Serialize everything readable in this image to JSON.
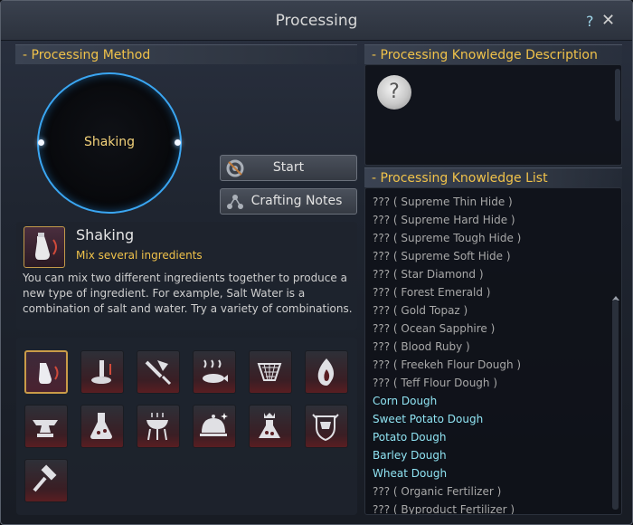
{
  "window": {
    "title": "Processing",
    "help_label": "?",
    "close_label": "✕"
  },
  "method_section": {
    "header": "- Processing Method"
  },
  "circle": {
    "label": "Shaking",
    "ring_color": "#3aa6f2"
  },
  "buttons": {
    "start": "Start",
    "crafting_notes": "Crafting Notes"
  },
  "selected_method": {
    "name": "Shaking",
    "subtitle": "Mix several ingredients",
    "description": "You can mix two different ingredients together to produce a new type of ingredient. For example, Salt Water is a combination of salt and water. Try a variety of combinations."
  },
  "method_icons": [
    {
      "name": "shaking-icon",
      "selected": true
    },
    {
      "name": "grinding-icon",
      "selected": false
    },
    {
      "name": "chopping-icon",
      "selected": false
    },
    {
      "name": "drying-icon",
      "selected": false
    },
    {
      "name": "filtering-icon",
      "selected": false
    },
    {
      "name": "heating-icon",
      "selected": false
    },
    {
      "name": "anvil-icon",
      "selected": false
    },
    {
      "name": "alchemy-flask-icon",
      "selected": false
    },
    {
      "name": "grill-icon",
      "selected": false
    },
    {
      "name": "cooking-cloche-icon",
      "selected": false
    },
    {
      "name": "imperial-alchemy-icon",
      "selected": false
    },
    {
      "name": "guild-crest-icon",
      "selected": false
    },
    {
      "name": "hammer-icon",
      "selected": false
    }
  ],
  "description_section": {
    "header": "- Processing Knowledge Description",
    "placeholder_icon": "?"
  },
  "list_section": {
    "header": "- Processing Knowledge List",
    "items": [
      {
        "label": "??? ( Supreme Thin Hide )",
        "known": false
      },
      {
        "label": "??? ( Supreme Hard Hide )",
        "known": false
      },
      {
        "label": "??? ( Supreme Tough Hide )",
        "known": false
      },
      {
        "label": "??? ( Supreme Soft Hide )",
        "known": false
      },
      {
        "label": "??? ( Star Diamond )",
        "known": false
      },
      {
        "label": "??? ( Forest Emerald )",
        "known": false
      },
      {
        "label": "??? ( Gold Topaz )",
        "known": false
      },
      {
        "label": "??? ( Ocean Sapphire )",
        "known": false
      },
      {
        "label": "??? ( Blood Ruby )",
        "known": false
      },
      {
        "label": "??? ( Freekeh Flour Dough )",
        "known": false
      },
      {
        "label": "??? ( Teff Flour Dough )",
        "known": false
      },
      {
        "label": "Corn Dough",
        "known": true
      },
      {
        "label": "Sweet Potato Dough",
        "known": true
      },
      {
        "label": "Potato Dough",
        "known": true
      },
      {
        "label": "Barley Dough",
        "known": true
      },
      {
        "label": "Wheat Dough",
        "known": true
      },
      {
        "label": "??? ( Organic Fertilizer )",
        "known": false
      },
      {
        "label": "??? ( Byproduct Fertilizer )",
        "known": false
      }
    ]
  },
  "colors": {
    "header_text": "#f0c24a",
    "known_item": "#8fe3f2",
    "unknown_item": "#a8a8a8",
    "selected_border": "#c99b48"
  }
}
